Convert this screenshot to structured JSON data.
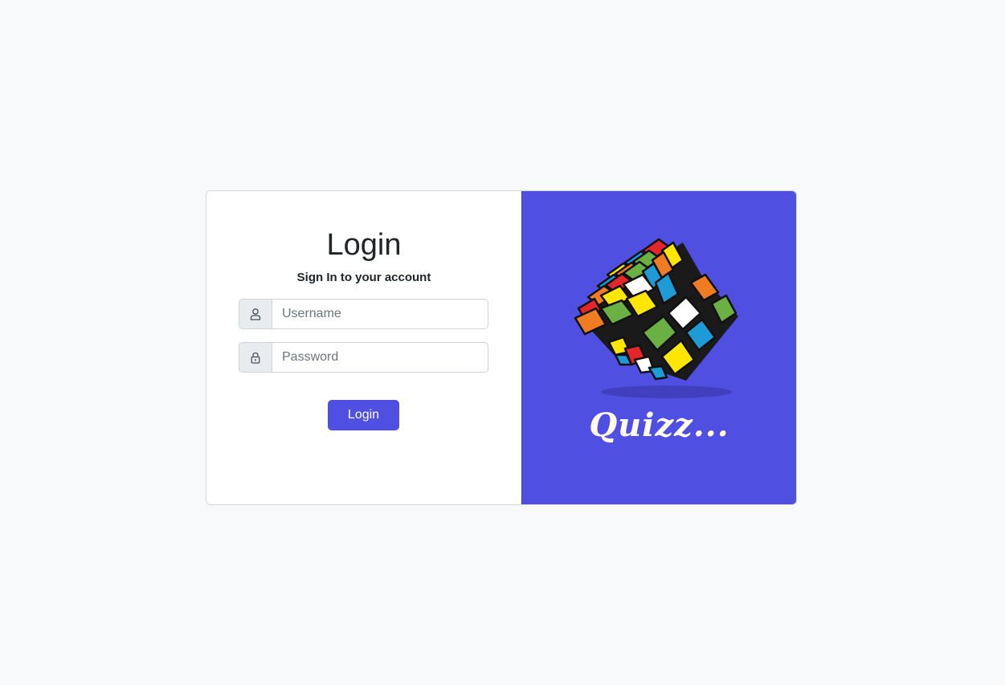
{
  "login": {
    "title": "Login",
    "subtitle": "Sign In to your account",
    "username_placeholder": "Username",
    "password_placeholder": "Password",
    "submit_label": "Login",
    "user_icon": "user-icon",
    "lock_icon": "lock-icon"
  },
  "brand": {
    "text": "Quizz...",
    "illustration": "rubiks-cube-icon"
  },
  "colors": {
    "accent": "#4f4fe2",
    "page_background": "#f8f9fa"
  }
}
